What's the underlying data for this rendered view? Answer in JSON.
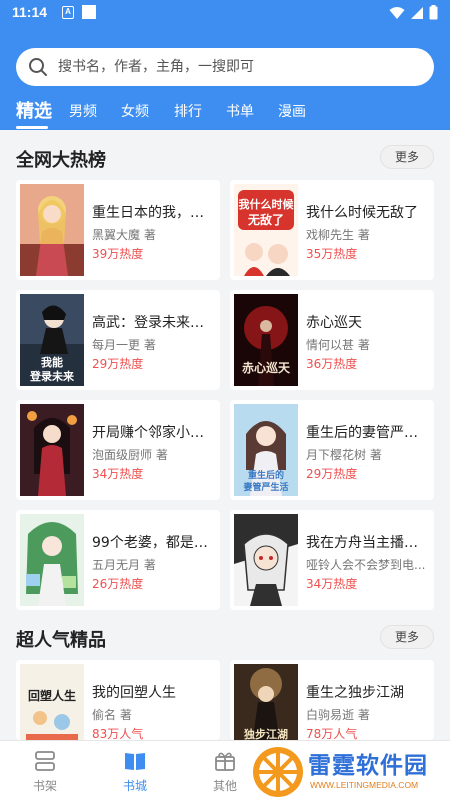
{
  "status_bar": {
    "time": "11:14",
    "notification_icon": "A"
  },
  "search": {
    "placeholder": "搜书名，作者，主角，一搜即可"
  },
  "tabs": [
    {
      "label": "精选",
      "active": true
    },
    {
      "label": "男频"
    },
    {
      "label": "女频"
    },
    {
      "label": "排行"
    },
    {
      "label": "书单"
    },
    {
      "label": "漫画"
    }
  ],
  "sections": [
    {
      "title": "全网大热榜",
      "more_label": "更多",
      "books": [
        {
          "title": "重生日本的我，在...",
          "author": "黑翼大魔 著",
          "heat": "39万热度",
          "cover_color": "#e7a88c"
        },
        {
          "title": "我什么时候无敌了",
          "author": "戏柳先生 著",
          "heat": "35万热度",
          "cover_color": "#d6342c",
          "cover_text": "我什么时候无敌了"
        },
        {
          "title": "高武：登录未来一...",
          "author": "每月一更 著",
          "heat": "29万热度",
          "cover_color": "#25303f",
          "cover_text": "我能登录未来"
        },
        {
          "title": "赤心巡天",
          "author": "情何以甚 著",
          "heat": "36万热度",
          "cover_color": "#5a1012",
          "cover_text": "赤心巡天"
        },
        {
          "title": "开局赚个邻家小姐...",
          "author": "泡面级厨师 著",
          "heat": "34万热度",
          "cover_color": "#7a2a32"
        },
        {
          "title": "重生后的妻管严生...",
          "author": "月下樱花树 著",
          "heat": "29万热度",
          "cover_color": "#6fa7c9",
          "cover_text": "重生后的妻管严生活"
        },
        {
          "title": "99个老婆，都是我...",
          "author": "五月无月 著",
          "heat": "26万热度",
          "cover_color": "#4c9b5c"
        },
        {
          "title": "我在方舟当主播，...",
          "author": "哑铃人会不会梦到电...",
          "heat": "34万热度",
          "cover_color": "#3a3a3a"
        }
      ]
    },
    {
      "title": "超人气精品",
      "more_label": "更多",
      "books": [
        {
          "title": "我的回塑人生",
          "author": "偷名 著",
          "heat": "83万人气",
          "cover_color": "#f6f1e6",
          "cover_text": "回塑人生"
        },
        {
          "title": "重生之独步江湖",
          "author": "白驹易逝 著",
          "heat": "78万人气",
          "cover_color": "#7a5a3a",
          "cover_text": "独步江湖"
        }
      ]
    }
  ],
  "bottom_nav": [
    {
      "label": "书架",
      "icon": "bookshelf-icon"
    },
    {
      "label": "书城",
      "icon": "bookstore-icon",
      "active": true
    },
    {
      "label": "其他",
      "icon": "gift-icon"
    }
  ],
  "watermark": {
    "text": "雷霆软件园",
    "url": "WWW.LEITINGMEDIA.COM"
  },
  "colors": {
    "primary": "#3d8ef0",
    "heat": "#ef4f4f"
  }
}
